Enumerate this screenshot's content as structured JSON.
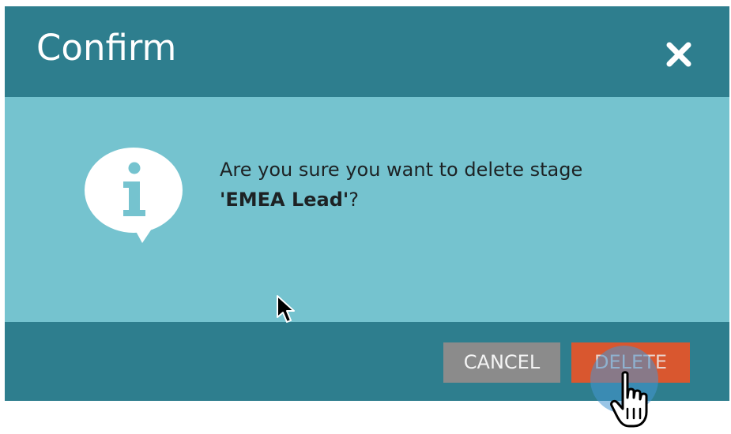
{
  "dialog": {
    "title": "Confirm",
    "close_icon": "close-icon",
    "info_icon": "info-speech-bubble-icon",
    "message": {
      "prefix": "Are you sure you want to delete stage",
      "stage_name": "'EMEA Lead'",
      "suffix": "?"
    },
    "buttons": {
      "cancel_label": "CANCEL",
      "delete_label": "DELETE"
    }
  },
  "colors": {
    "header_footer": "#2e7e8e",
    "body": "#75c3cf",
    "cancel_button": "#8b8b8b",
    "delete_button": "#d9572f"
  },
  "cursors": {
    "pointer": "arrow-cursor-icon",
    "hand": "hand-pointer-cursor-icon"
  }
}
